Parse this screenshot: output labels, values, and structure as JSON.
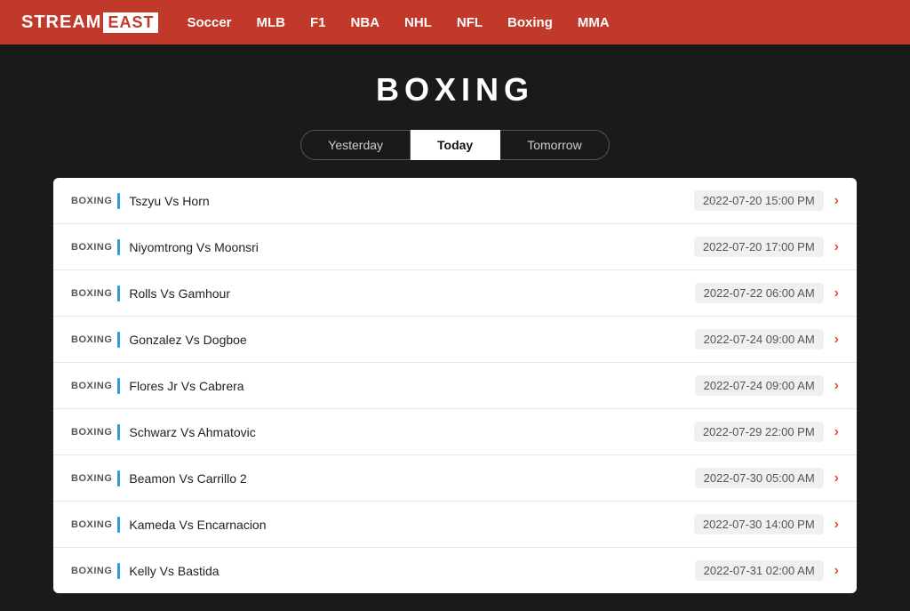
{
  "brand": {
    "stream": "STREAM",
    "east": "EAST"
  },
  "nav": {
    "items": [
      {
        "label": "Soccer",
        "id": "soccer"
      },
      {
        "label": "MLB",
        "id": "mlb"
      },
      {
        "label": "F1",
        "id": "f1"
      },
      {
        "label": "NBA",
        "id": "nba"
      },
      {
        "label": "NHL",
        "id": "nhl"
      },
      {
        "label": "NFL",
        "id": "nfl"
      },
      {
        "label": "Boxing",
        "id": "boxing"
      },
      {
        "label": "MMA",
        "id": "mma"
      }
    ]
  },
  "page": {
    "title": "BOXING"
  },
  "tabs": [
    {
      "label": "Yesterday",
      "id": "yesterday",
      "active": false
    },
    {
      "label": "Today",
      "id": "today",
      "active": true
    },
    {
      "label": "Tomorrow",
      "id": "tomorrow",
      "active": false
    }
  ],
  "matches": [
    {
      "sport": "BOXING",
      "color": "#3498db",
      "name": "Tszyu Vs Horn",
      "date": "2022-07-20 15:00 PM"
    },
    {
      "sport": "BOXING",
      "color": "#3498db",
      "name": "Niyomtrong Vs Moonsri",
      "date": "2022-07-20 17:00 PM"
    },
    {
      "sport": "BOXING",
      "color": "#3498db",
      "name": "Rolls Vs Gamhour",
      "date": "2022-07-22 06:00 AM"
    },
    {
      "sport": "BOXING",
      "color": "#3498db",
      "name": "Gonzalez Vs Dogboe",
      "date": "2022-07-24 09:00 AM"
    },
    {
      "sport": "BOXING",
      "color": "#3498db",
      "name": "Flores Jr Vs Cabrera",
      "date": "2022-07-24 09:00 AM"
    },
    {
      "sport": "BOXING",
      "color": "#3498db",
      "name": "Schwarz Vs Ahmatovic",
      "date": "2022-07-29 22:00 PM"
    },
    {
      "sport": "BOXING",
      "color": "#3498db",
      "name": "Beamon Vs Carrillo 2",
      "date": "2022-07-30 05:00 AM"
    },
    {
      "sport": "BOXING",
      "color": "#3498db",
      "name": "Kameda Vs Encarnacion",
      "date": "2022-07-30 14:00 PM"
    },
    {
      "sport": "BOXING",
      "color": "#3498db",
      "name": "Kelly Vs Bastida",
      "date": "2022-07-31 02:00 AM"
    }
  ]
}
